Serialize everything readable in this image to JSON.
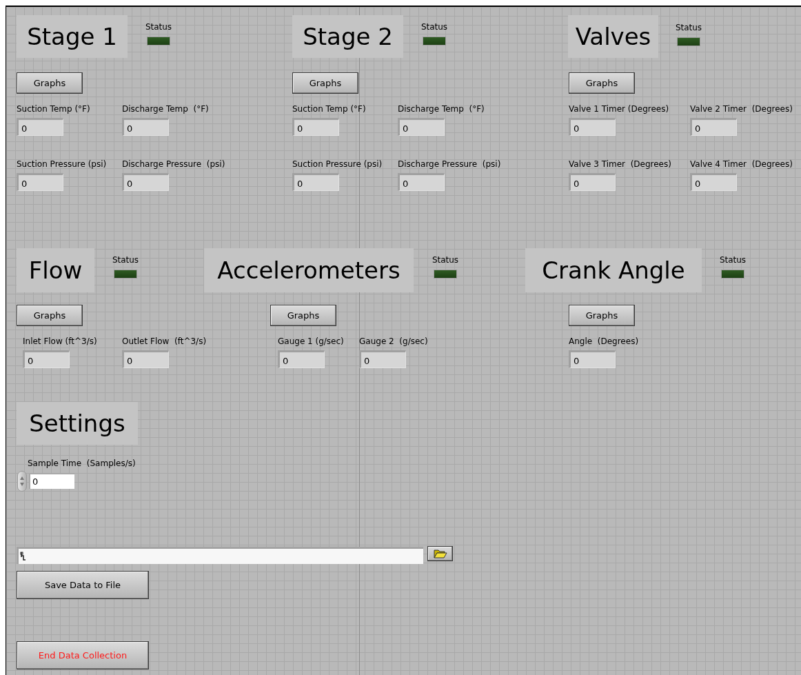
{
  "sections": [
    {
      "title": "Stage 1",
      "status": {
        "label": "Status",
        "on": false
      },
      "graphs_button": "Graphs",
      "fields": [
        {
          "label": "Suction Temp (°F)",
          "value": "0"
        },
        {
          "label": "Discharge Temp  (°F)",
          "value": "0"
        },
        {
          "label": "Suction Pressure (psi)",
          "value": "0"
        },
        {
          "label": "Discharge Pressure  (psi)",
          "value": "0"
        }
      ]
    },
    {
      "title": "Stage 2",
      "status": {
        "label": "Status",
        "on": false
      },
      "graphs_button": "Graphs",
      "fields": [
        {
          "label": "Suction Temp (°F)",
          "value": "0"
        },
        {
          "label": "Discharge Temp  (°F)",
          "value": "0"
        },
        {
          "label": "Suction Pressure (psi)",
          "value": "0"
        },
        {
          "label": "Discharge Pressure  (psi)",
          "value": "0"
        }
      ]
    },
    {
      "title": "Valves",
      "status": {
        "label": "Status",
        "on": false
      },
      "graphs_button": "Graphs",
      "fields": [
        {
          "label": "Valve 1 Timer (Degrees)",
          "value": "0"
        },
        {
          "label": "Valve 2 Timer  (Degrees)",
          "value": "0"
        },
        {
          "label": "Valve 3 Timer  (Degrees)",
          "value": "0"
        },
        {
          "label": "Valve 4 Timer  (Degrees)",
          "value": "0"
        }
      ]
    },
    {
      "title": "Flow",
      "status": {
        "label": "Status",
        "on": false
      },
      "graphs_button": "Graphs",
      "fields": [
        {
          "label": "Inlet Flow (ft^3/s)",
          "value": "0"
        },
        {
          "label": "Outlet Flow  (ft^3/s)",
          "value": "0"
        }
      ]
    },
    {
      "title": "Accelerometers",
      "status": {
        "label": "Status",
        "on": false
      },
      "graphs_button": "Graphs",
      "fields": [
        {
          "label": "Gauge 1 (g/sec)",
          "value": "0"
        },
        {
          "label": "Gauge 2  (g/sec)",
          "value": "0"
        }
      ]
    },
    {
      "title": "Crank Angle",
      "status": {
        "label": "Status",
        "on": false
      },
      "graphs_button": "Graphs",
      "fields": [
        {
          "label": "Angle  (Degrees)",
          "value": "0"
        }
      ]
    }
  ],
  "settings": {
    "title": "Settings",
    "sample_time": {
      "label": "Sample Time  (Samples/s)",
      "value": "0"
    }
  },
  "save_button": "Save Data to File",
  "end_button": "End Data Collection"
}
